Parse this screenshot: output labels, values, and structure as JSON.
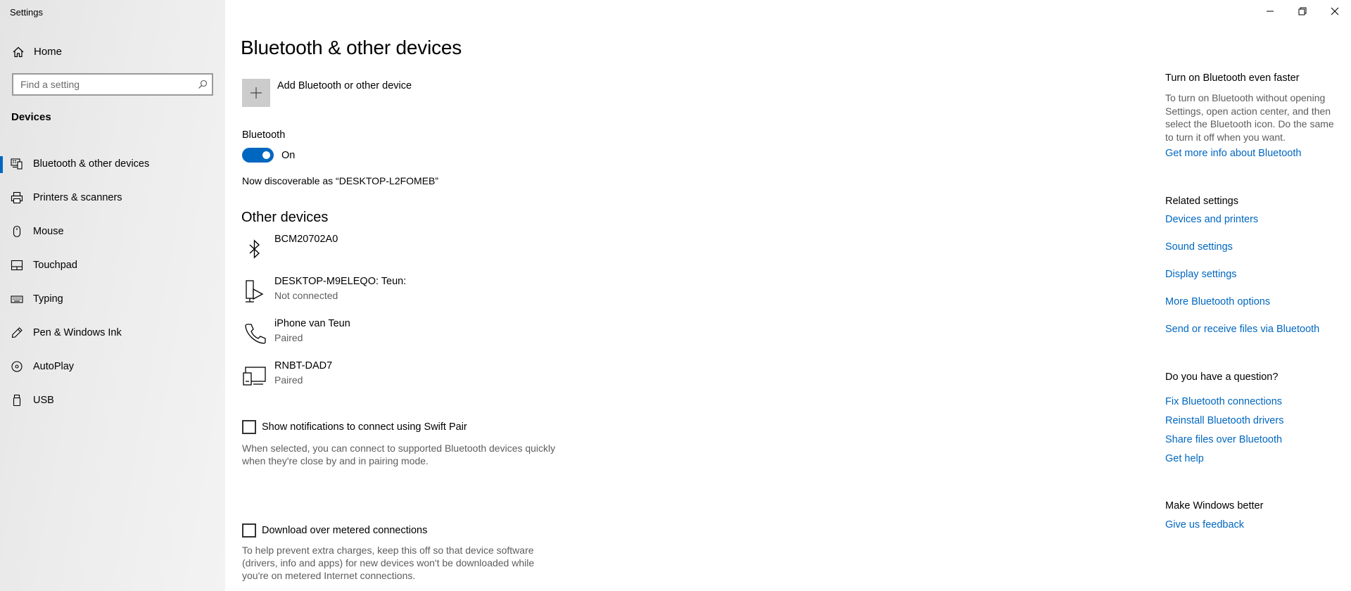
{
  "window": {
    "title": "Settings"
  },
  "sidebar": {
    "home_label": "Home",
    "search_placeholder": "Find a setting",
    "section": "Devices",
    "items": [
      {
        "label": "Bluetooth & other devices",
        "icon": "bluetooth-devices-icon",
        "active": true
      },
      {
        "label": "Printers & scanners",
        "icon": "printer-icon"
      },
      {
        "label": "Mouse",
        "icon": "mouse-icon"
      },
      {
        "label": "Touchpad",
        "icon": "touchpad-icon"
      },
      {
        "label": "Typing",
        "icon": "keyboard-icon"
      },
      {
        "label": "Pen & Windows Ink",
        "icon": "pen-icon"
      },
      {
        "label": "AutoPlay",
        "icon": "autoplay-icon"
      },
      {
        "label": "USB",
        "icon": "usb-icon"
      }
    ]
  },
  "main": {
    "title": "Bluetooth & other devices",
    "add_device_label": "Add Bluetooth or other device",
    "bluetooth_label": "Bluetooth",
    "bluetooth_state": "On",
    "bluetooth_on": true,
    "discoverable": "Now discoverable as “DESKTOP-L2FOMEB”",
    "other_devices_heading": "Other devices",
    "devices": [
      {
        "name": "BCM20702A0",
        "status": "",
        "icon": "bluetooth-icon"
      },
      {
        "name": "DESKTOP-M9ELEQO: Teun:",
        "status": "Not connected",
        "icon": "media-device-icon"
      },
      {
        "name": "iPhone van Teun",
        "status": "Paired",
        "icon": "phone-icon"
      },
      {
        "name": "RNBT-DAD7",
        "status": "Paired",
        "icon": "devices-icon"
      }
    ],
    "swift_pair_label": "Show notifications to connect using Swift Pair",
    "swift_pair_desc_1": "When selected, you can connect to supported Bluetooth devices quickly",
    "swift_pair_desc_2": "when they're close by and in pairing mode.",
    "metered_label": "Download over metered connections",
    "metered_desc_1": "To help prevent extra charges, keep this off so that device software",
    "metered_desc_2": "(drivers, info and apps) for new devices won't be downloaded while",
    "metered_desc_3": "you're on metered Internet connections."
  },
  "right": {
    "faster_heading": "Turn on Bluetooth even faster",
    "faster_text_1": "To turn on Bluetooth without opening",
    "faster_text_2": "Settings, open action center, and then",
    "faster_text_3": "select the Bluetooth icon. Do the same",
    "faster_text_4": "to turn it off when you want.",
    "more_info_link": "Get more info about Bluetooth",
    "related_heading": "Related settings",
    "related_links": [
      "Devices and printers",
      "Sound settings",
      "Display settings",
      "More Bluetooth options",
      "Send or receive files via Bluetooth"
    ],
    "question_heading": "Do you have a question?",
    "question_links": [
      "Fix Bluetooth connections",
      "Reinstall Bluetooth drivers",
      "Share files over Bluetooth",
      "Get help"
    ],
    "better_heading": "Make Windows better",
    "feedback_link": "Give us feedback"
  },
  "colors": {
    "accent": "#0067c0",
    "secondary_text": "#5d5d5d"
  }
}
